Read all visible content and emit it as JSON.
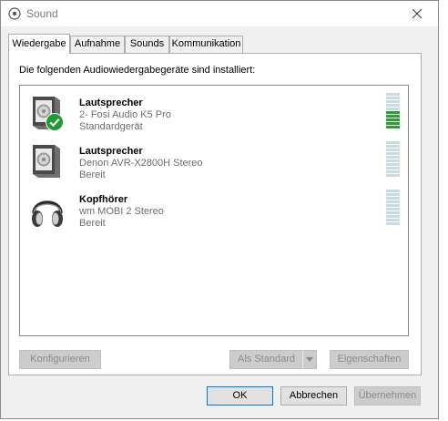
{
  "window": {
    "title": "Sound"
  },
  "tabs": [
    {
      "label": "Wiedergabe",
      "active": true
    },
    {
      "label": "Aufnahme",
      "active": false
    },
    {
      "label": "Sounds",
      "active": false
    },
    {
      "label": "Kommunikation",
      "active": false
    }
  ],
  "panel": {
    "heading": "Die folgenden Audiowiedergabegeräte sind installiert:",
    "devices": [
      {
        "name": "Lautsprecher",
        "description": "2- Fosi Audio K5 Pro",
        "status": "Standardgerät",
        "icon": "speaker-icon",
        "is_default": true,
        "level_fraction": 0.5
      },
      {
        "name": "Lautsprecher",
        "description": "Denon AVR-X2800H Stereo",
        "status": "Bereit",
        "icon": "speaker-icon",
        "is_default": false,
        "level_fraction": 0
      },
      {
        "name": "Kopfhörer",
        "description": "wm MOBI 2 Stereo",
        "status": "Bereit",
        "icon": "headphones-icon",
        "is_default": false,
        "level_fraction": 0
      }
    ],
    "buttons": {
      "configure": "Konfigurieren",
      "set_default": "Als Standard",
      "properties": "Eigenschaften"
    }
  },
  "footer": {
    "ok": "OK",
    "cancel": "Abbrechen",
    "apply": "Übernehmen"
  },
  "colors": {
    "accent": "#0078d7",
    "meter_active": "#2e9e3a",
    "meter_inactive": "#c8dbe0",
    "default_check": "#1f9b33"
  }
}
